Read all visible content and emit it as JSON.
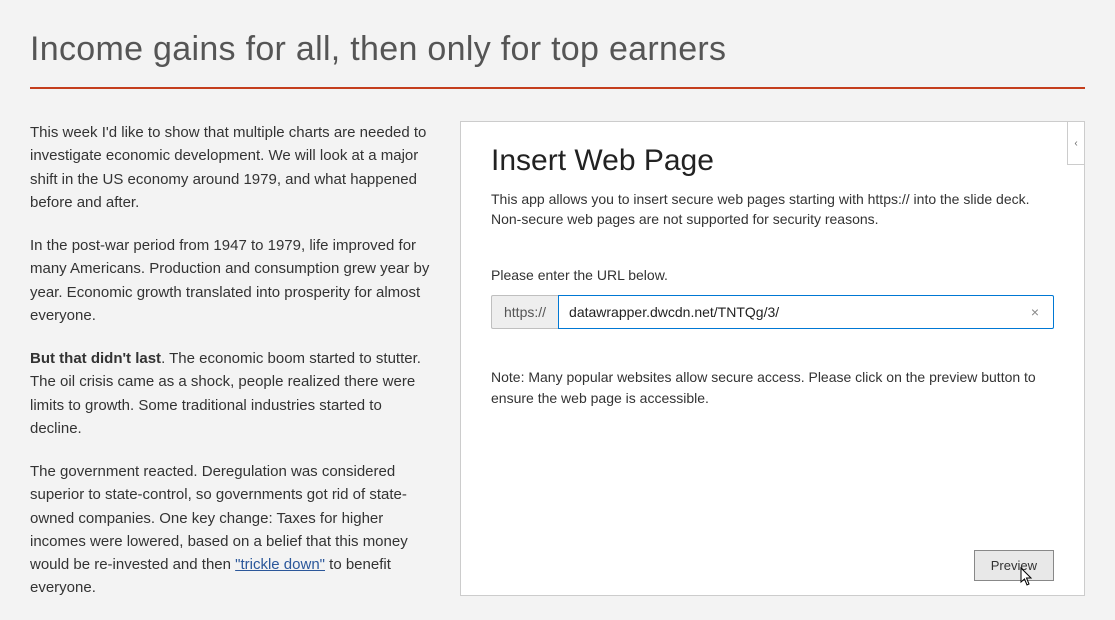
{
  "page": {
    "title": "Income gains for all, then only for top earners"
  },
  "article": {
    "p1": "This week I'd like to show that multiple charts are needed to investigate economic development. We will look at a major shift in the US economy around 1979, and what happened before and after.",
    "p2": "In the post-war period from 1947 to 1979, life improved for many Americans. Production and consumption grew year by year. Economic growth translated into prosperity for almost everyone.",
    "p3_strong": "But that didn't last",
    "p3_tail": ". The economic boom started to stutter. The oil crisis came as a shock, people realized there were limits to growth. Some traditional industries started to decline.",
    "p4_pre": "The government reacted. Deregulation was considered superior to state-control, so governments got rid of state-owned companies. One key change: Taxes for higher incomes were lowered, based on a belief that this money would be re-invested and then ",
    "p4_link": "\"trickle down\"",
    "p4_post": " to benefit everyone."
  },
  "panel": {
    "title": "Insert Web Page",
    "description": "This app allows you to insert secure web pages starting with https:// into the slide deck. Non-secure web pages are not supported for security reasons.",
    "url_label": "Please enter the URL below.",
    "url_prefix": "https://",
    "url_value": "datawrapper.dwcdn.net/TNTQg/3/",
    "clear_symbol": "×",
    "note": "Note: Many popular websites allow secure access. Please click on the preview button to ensure the web page is accessible.",
    "preview_label": "Preview",
    "collapse_glyph": "‹"
  }
}
